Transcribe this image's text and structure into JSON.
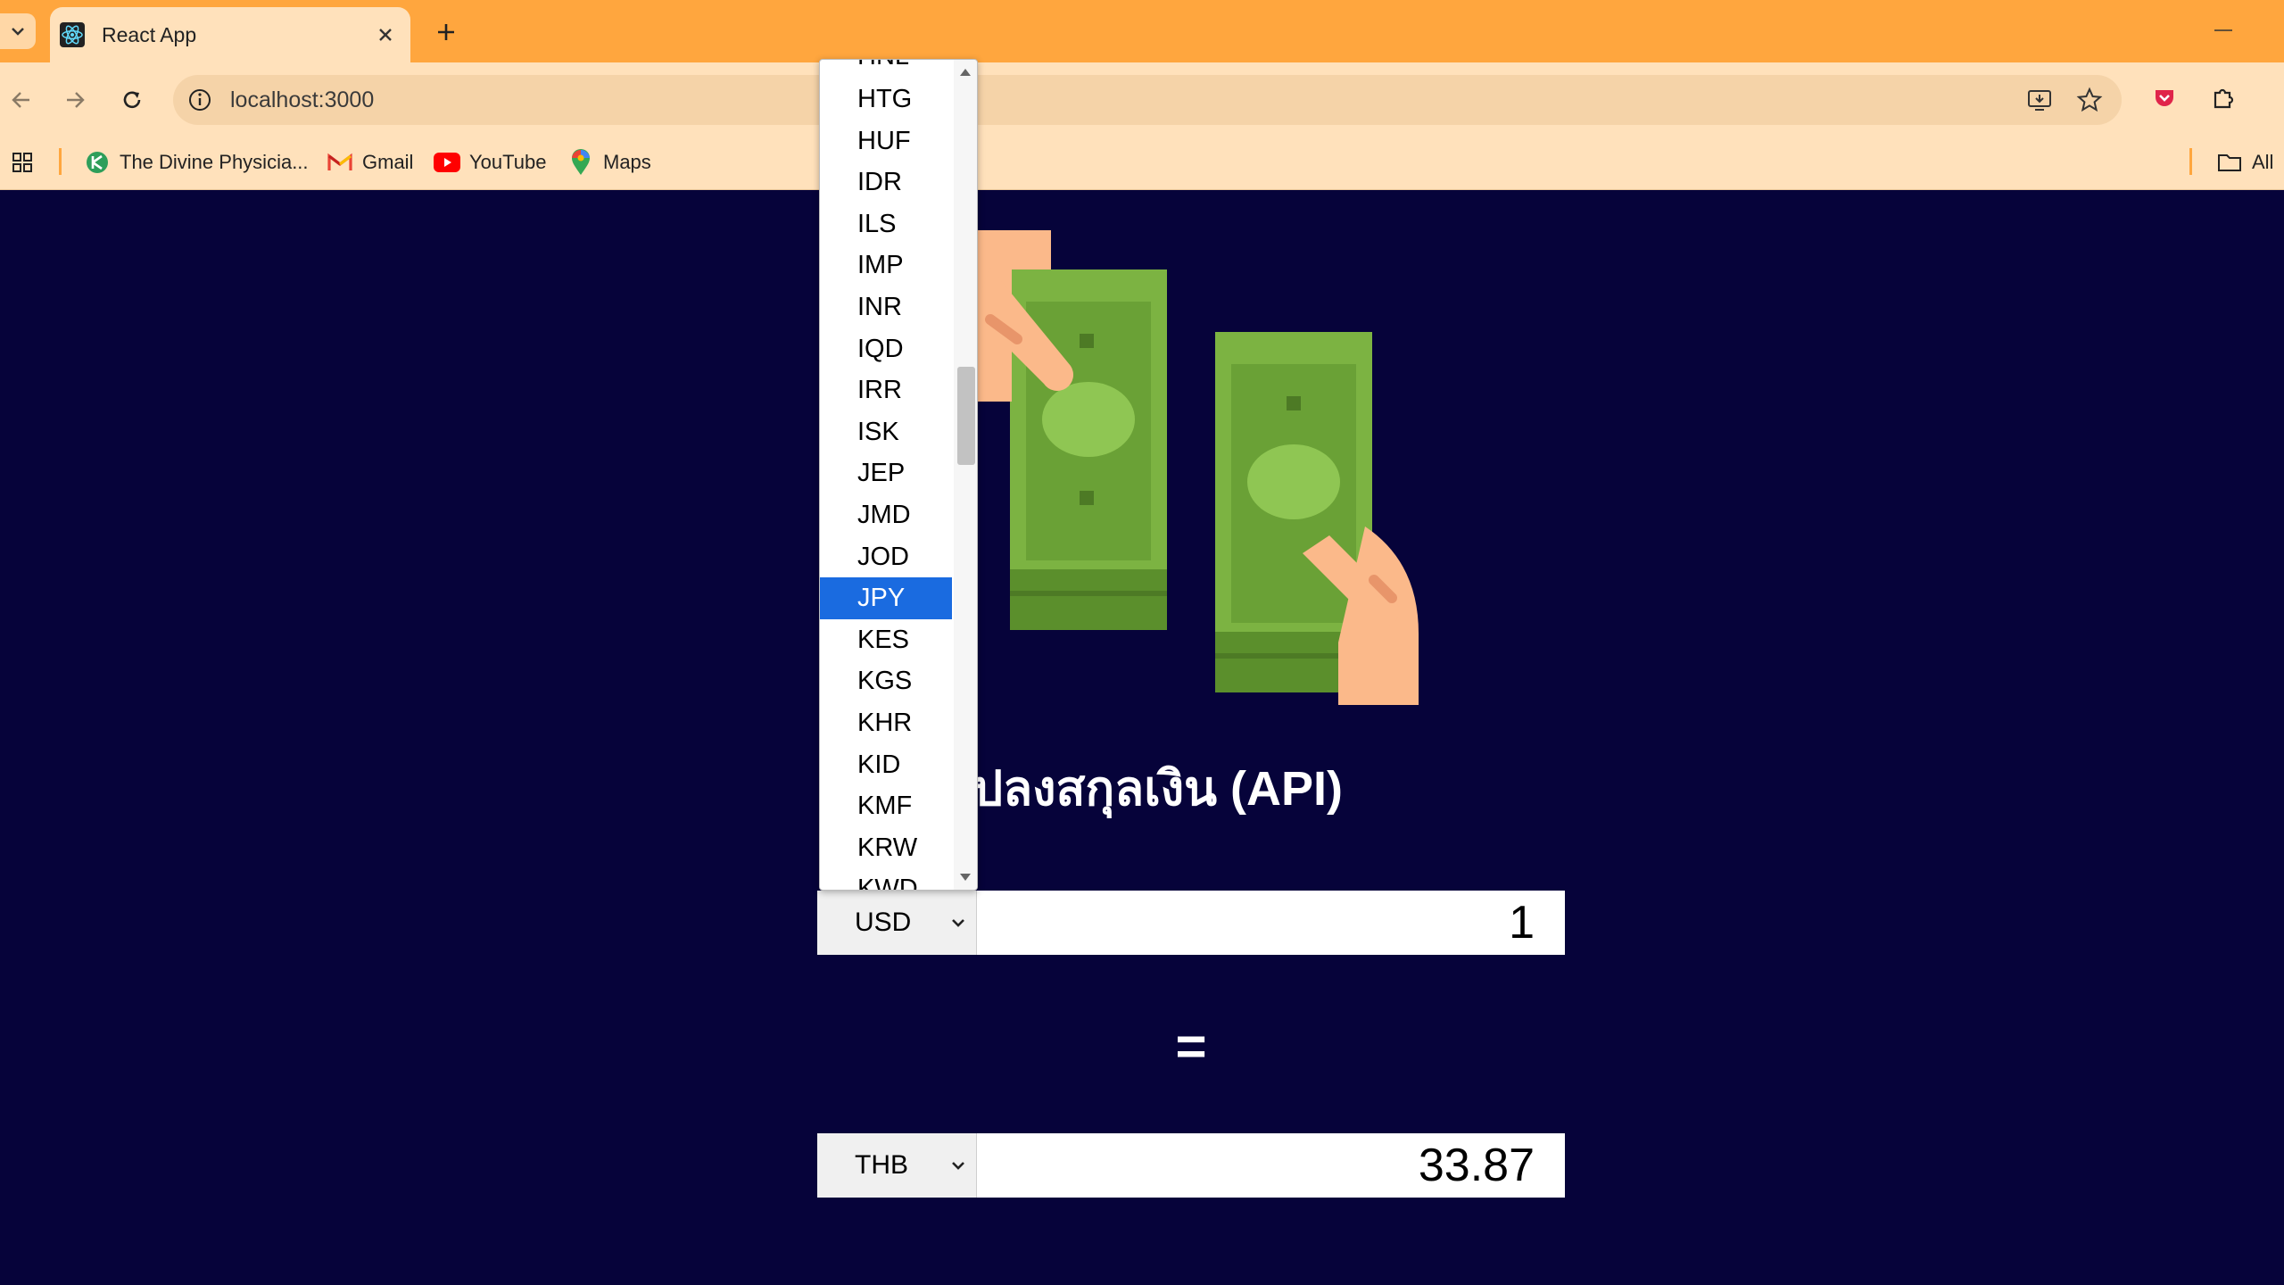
{
  "browser": {
    "tab_title": "React App",
    "url": "localhost:3000",
    "bookmarks": [
      {
        "label": "The Divine Physicia..."
      },
      {
        "label": "Gmail"
      },
      {
        "label": "YouTube"
      },
      {
        "label": "Maps"
      }
    ],
    "all_bookmarks_label": "All"
  },
  "page": {
    "title": "แปลงสกุลเงิน (API)",
    "from": {
      "currency": "USD",
      "amount": "1"
    },
    "equals": "=",
    "to": {
      "currency": "THB",
      "amount": "33.87"
    }
  },
  "dropdown": {
    "partial_top": "HNL",
    "options": [
      "HTG",
      "HUF",
      "IDR",
      "ILS",
      "IMP",
      "INR",
      "IQD",
      "IRR",
      "ISK",
      "JEP",
      "JMD",
      "JOD",
      "JPY",
      "KES",
      "KGS",
      "KHR",
      "KID",
      "KMF",
      "KRW",
      "KWD"
    ],
    "highlighted": "JPY"
  },
  "colors": {
    "page_bg": "#06033a",
    "tabbar": "#ffa63e",
    "toolbar": "#ffe1bb",
    "highlight": "#1a6be0",
    "money_green": "#7cb342",
    "money_dark": "#5b8f2c",
    "skin": "#fbb98a"
  }
}
